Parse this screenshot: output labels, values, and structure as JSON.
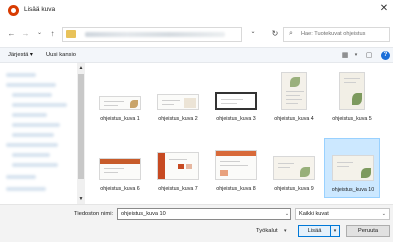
{
  "window": {
    "title": "Lisää kuva",
    "close_glyph": "✕"
  },
  "addressbar": {
    "back_glyph": "←",
    "forward_glyph": "→",
    "recent_glyph": "⌄",
    "up_glyph": "↑",
    "dropdown_glyph": "⌄",
    "refresh_glyph": "↻",
    "search_placeholder": "Hae: Tuotekuvat ohjeistus",
    "search_glyph": "⌕"
  },
  "commandbar": {
    "organize_label": "Järjestä ▾",
    "new_folder_label": "Uusi kansio",
    "view_glyph": "▦",
    "view_dd_glyph": "▾",
    "pane_glyph": "▢",
    "help_glyph": "?"
  },
  "navpane": {
    "scroll_up_glyph": "▲",
    "scroll_down_glyph": "▼"
  },
  "files": [
    {
      "name": "ohjeistus_kuva 1",
      "selected": false
    },
    {
      "name": "ohjeistus_kuva 2",
      "selected": false
    },
    {
      "name": "ohjeistus_kuva 3",
      "selected": false
    },
    {
      "name": "ohjeistus_kuva 4",
      "selected": false
    },
    {
      "name": "ohjeistus_kuva 5",
      "selected": false
    },
    {
      "name": "ohjeistus_kuva 6",
      "selected": false
    },
    {
      "name": "ohjeistus_kuva 7",
      "selected": false
    },
    {
      "name": "ohjeistus_kuva 8",
      "selected": false
    },
    {
      "name": "ohjeistus_kuva 9",
      "selected": false
    },
    {
      "name": "ohjeistus_kuva 10",
      "selected": true
    }
  ],
  "footer": {
    "filename_label": "Tiedoston nimi:",
    "filename_value": "ohjeistus_kuva 10",
    "filename_dd_glyph": "⌄",
    "filter_value": "Kaikki kuvat",
    "filter_dd_glyph": "⌄",
    "tools_label": "Työkalut",
    "tools_dd_glyph": "▾",
    "insert_label": "Lisää",
    "insert_split_glyph": "▾",
    "cancel_label": "Peruuta"
  },
  "colors": {
    "accent": "#0078d7",
    "selection": "#cce8ff",
    "app_icon": "#d83b01",
    "help_icon": "#1a6ed8"
  }
}
